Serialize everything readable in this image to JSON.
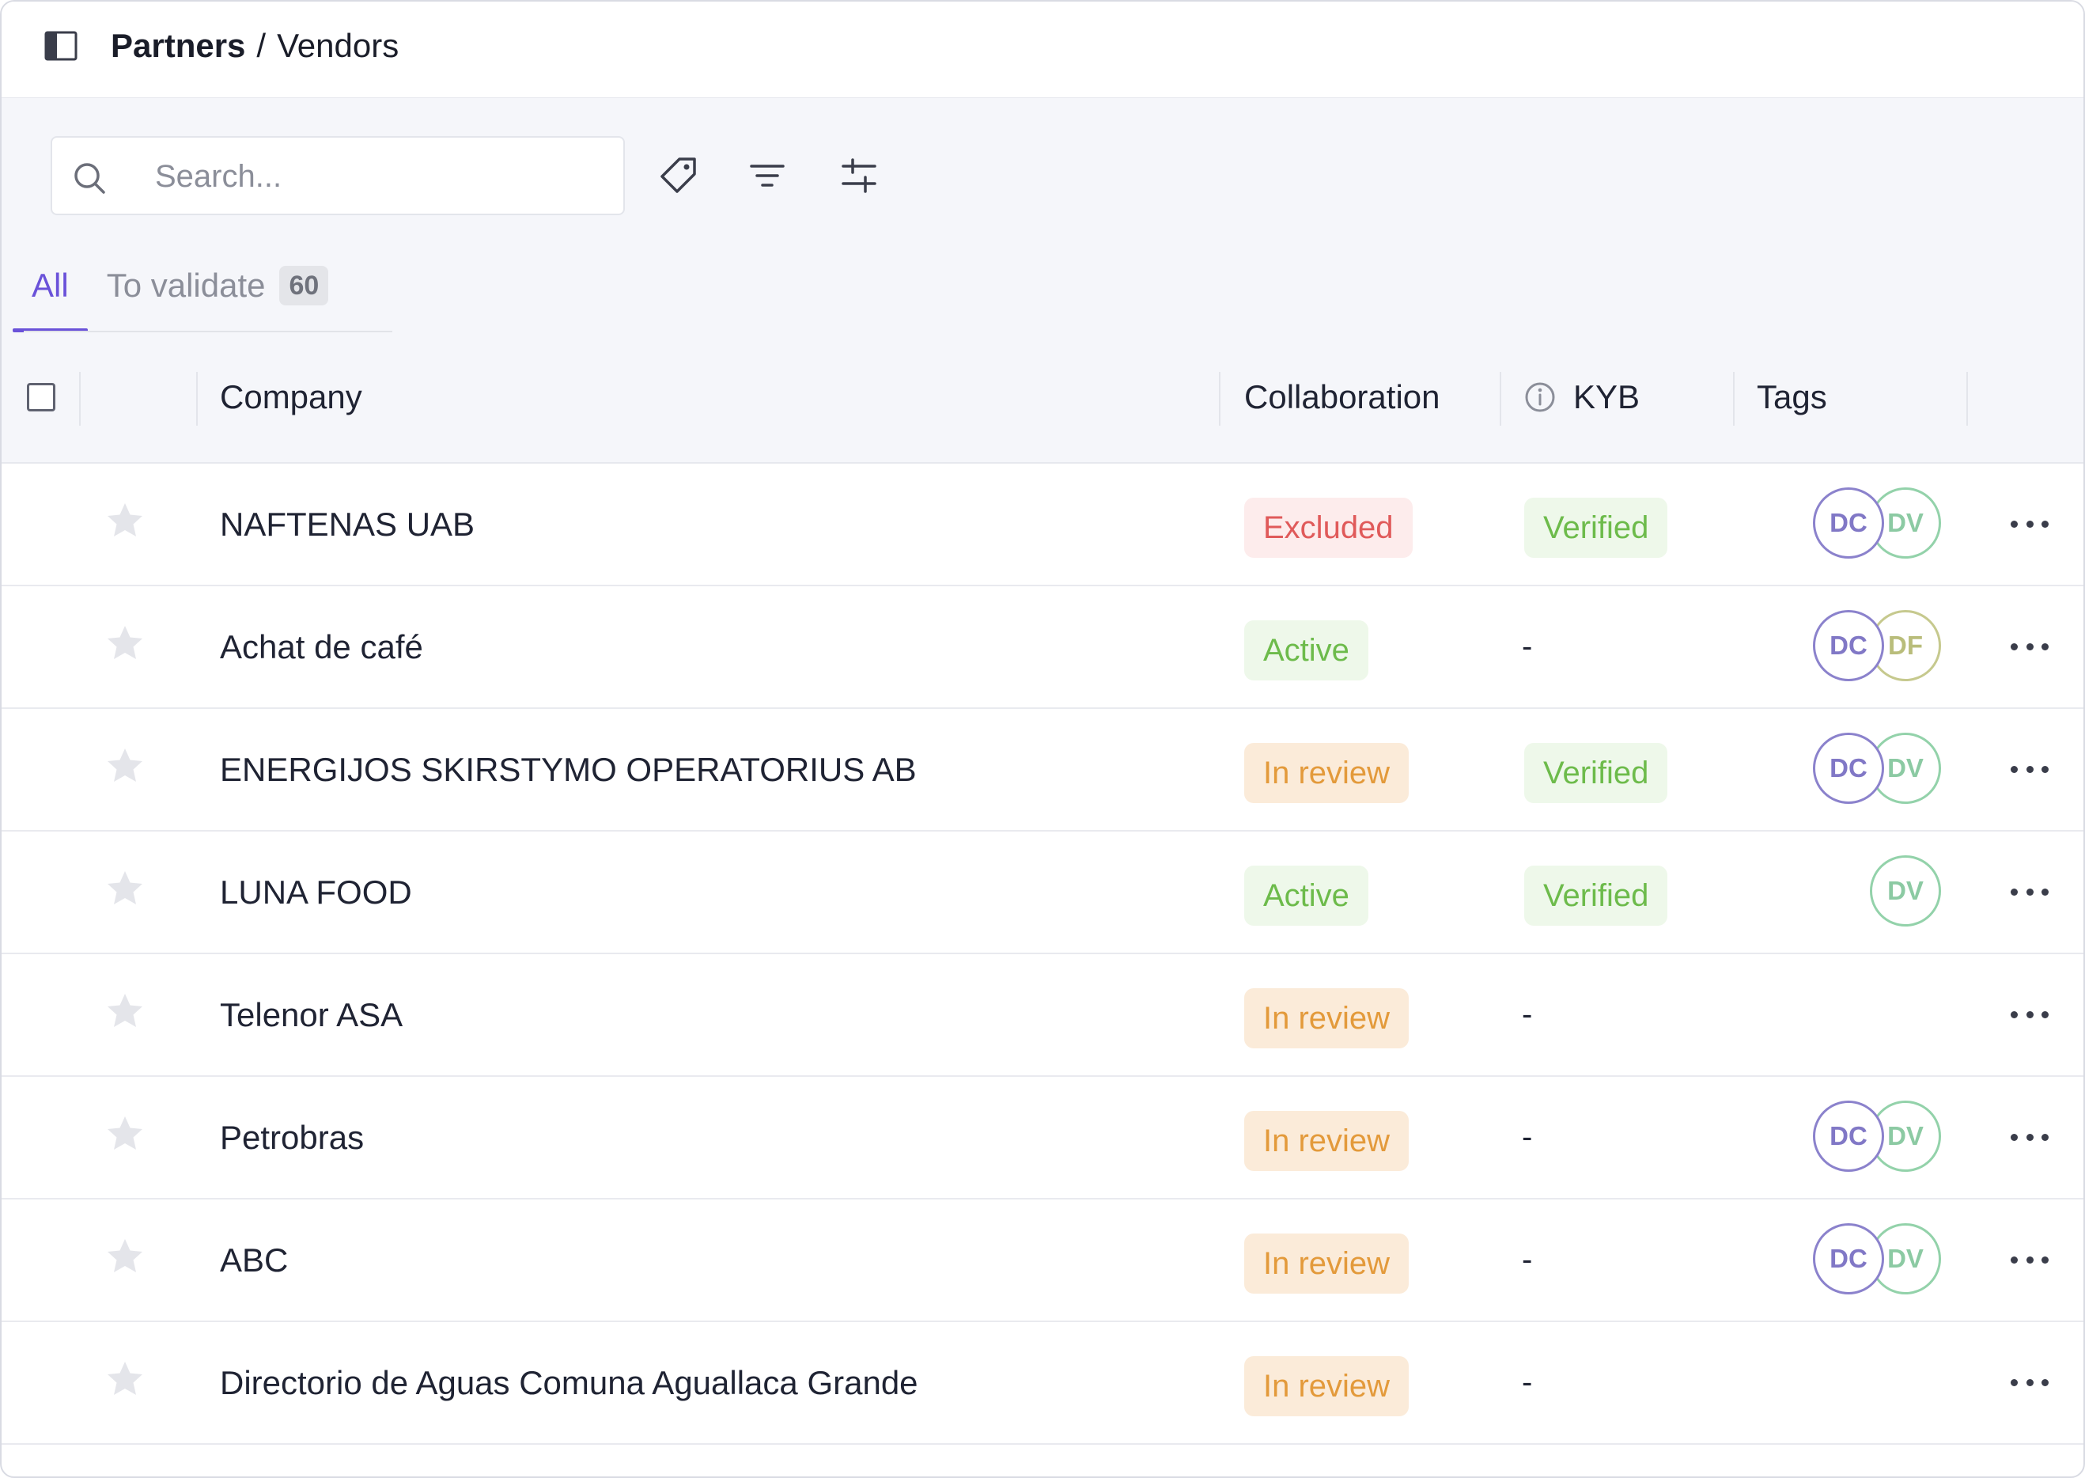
{
  "header": {
    "breadcrumb_parent": "Partners",
    "breadcrumb_sep": "/",
    "breadcrumb_current": "Vendors"
  },
  "toolbar": {
    "search_placeholder": "Search..."
  },
  "tabs": [
    {
      "label": "All",
      "active": true
    },
    {
      "label": "To validate",
      "count": "60",
      "active": false
    }
  ],
  "table": {
    "columns": {
      "company": "Company",
      "collaboration": "Collaboration",
      "kyb": "KYB",
      "tags": "Tags"
    },
    "rows": [
      {
        "company": "NAFTENAS UAB",
        "collaboration": "Excluded",
        "kyb": "Verified",
        "tags": [
          "DC",
          "DV"
        ]
      },
      {
        "company": "Achat de café",
        "collaboration": "Active",
        "kyb": "-",
        "tags": [
          "DC",
          "DF"
        ]
      },
      {
        "company": "ENERGIJOS SKIRSTYMO OPERATORIUS AB",
        "collaboration": "In review",
        "kyb": "Verified",
        "tags": [
          "DC",
          "DV"
        ]
      },
      {
        "company": "LUNA FOOD",
        "collaboration": "Active",
        "kyb": "Verified",
        "tags": [
          "DV"
        ]
      },
      {
        "company": "Telenor ASA",
        "collaboration": "In review",
        "kyb": "-",
        "tags": []
      },
      {
        "company": "Petrobras",
        "collaboration": "In review",
        "kyb": "-",
        "tags": [
          "DC",
          "DV"
        ]
      },
      {
        "company": "ABC",
        "collaboration": "In review",
        "kyb": "-",
        "tags": [
          "DC",
          "DV"
        ]
      },
      {
        "company": "Directorio de Aguas Comuna Aguallaca Grande",
        "collaboration": "In review",
        "kyb": "-",
        "tags": []
      }
    ]
  },
  "colors": {
    "accent": "#6a52d9",
    "excluded": "#e05a5a",
    "active": "#6dbb4b",
    "in_review": "#e39a3b"
  }
}
